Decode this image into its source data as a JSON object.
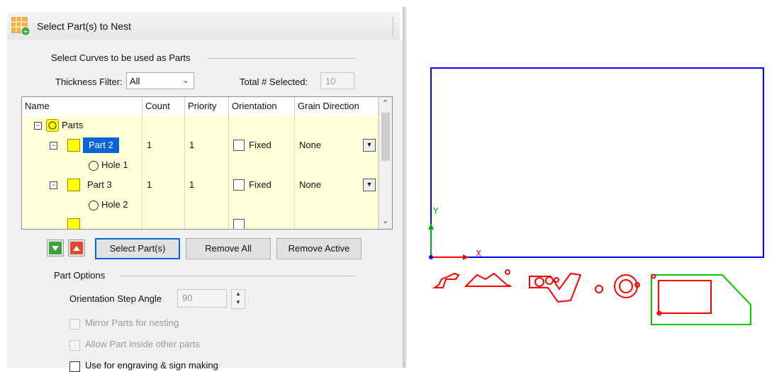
{
  "dialog": {
    "title": "Select Part(s) to Nest",
    "section_curves": "Select Curves to be used as Parts",
    "thickness_filter_label": "Thickness Filter:",
    "thickness_filter_value": "All",
    "total_selected_label": "Total # Selected:",
    "total_selected_value": "10"
  },
  "table": {
    "columns": [
      "Name",
      "Count",
      "Priority",
      "Orientation",
      "Grain Direction"
    ],
    "root_label": "Parts",
    "rows": [
      {
        "name": "Part 2",
        "count": "1",
        "priority": "1",
        "orientation": "Fixed",
        "grain": "None"
      },
      {
        "name": "Hole 1"
      },
      {
        "name": "Part 3",
        "count": "1",
        "priority": "1",
        "orientation": "Fixed",
        "grain": "None"
      },
      {
        "name": "Hole 2"
      }
    ]
  },
  "buttons": {
    "select_parts": "Select Part(s)",
    "remove_all": "Remove All",
    "remove_active": "Remove Active"
  },
  "part_options": {
    "header": "Part Options",
    "step_angle_label": "Orientation Step Angle",
    "step_angle_value": "90",
    "mirror_label": "Mirror Parts for nesting",
    "inside_label": "Allow Part inside other parts",
    "engraving_label": "Use for engraving & sign making"
  },
  "canvas": {
    "axis_x_label": "X",
    "axis_y_label": "Y",
    "sheet_color": "#0000ff",
    "part_color": "#ff0000",
    "active_part_color": "#00cc00"
  }
}
